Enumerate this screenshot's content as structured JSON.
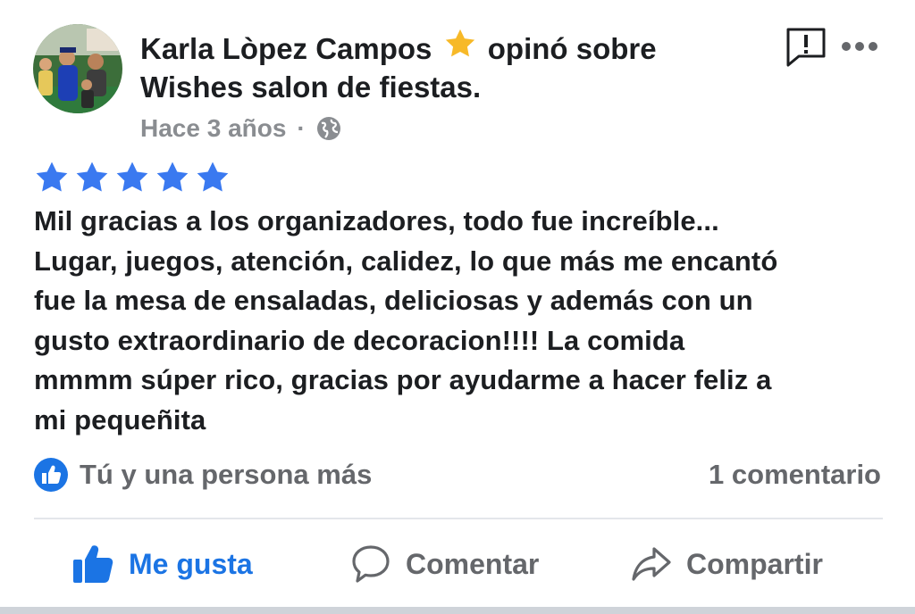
{
  "header": {
    "author_name": "Karla Lòpez Campos",
    "verb": "opinó sobre",
    "page_name": "Wishes salon de fiestas.",
    "timestamp": "Hace 3 años",
    "separator": "·",
    "privacy_icon": "globe-icon",
    "badge_icon": "star-badge-icon",
    "badge_color": "#f7b928"
  },
  "rating": {
    "stars": 5,
    "max": 5,
    "color": "#3a79f0"
  },
  "review": {
    "lines": [
      "Mil gracias a los organizadores, todo fue increíble...",
      "Lugar, juegos, atención, calidez, lo que más me encantó",
      "fue la mesa de ensaladas, deliciosas y además con un",
      "gusto extraordinario de decoracion!!!! La comida",
      "mmmm súper rico, gracias por ayudarme a hacer feliz a",
      "mi pequeñita"
    ]
  },
  "reactions": {
    "summary": "Tú y una persona más",
    "icon": "like-reaction-icon"
  },
  "comments": {
    "count_label": "1 comentario"
  },
  "actions": {
    "like_label": "Me gusta",
    "comment_label": "Comentar",
    "share_label": "Compartir"
  },
  "colors": {
    "accent": "#1b74e4",
    "secondary_text": "#65676b",
    "meta_text": "#8a8d91"
  }
}
